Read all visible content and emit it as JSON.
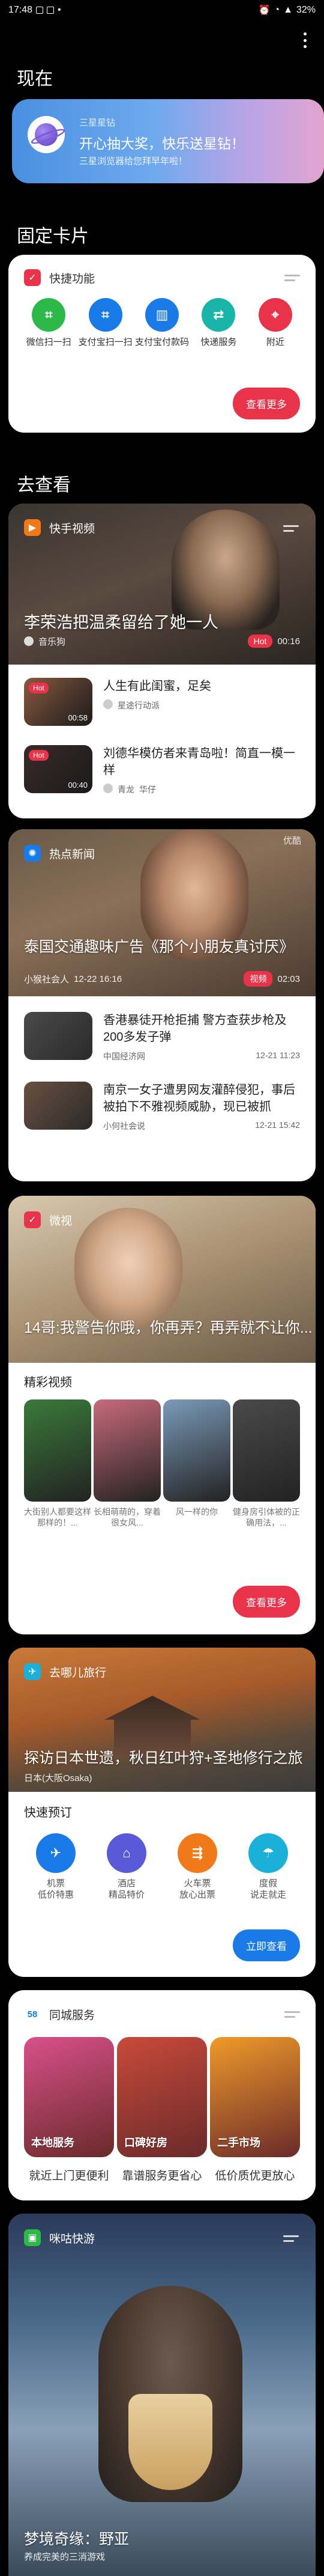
{
  "status": {
    "time": "17:48",
    "battery": "32%"
  },
  "sections": {
    "now": "现在",
    "fixed": "固定卡片",
    "browse": "去查看"
  },
  "banner": {
    "small": "三星星钻",
    "title": "开心抽大奖，快乐送星钻！",
    "sub": "三星浏览器给您拜早年啦！"
  },
  "quick": {
    "title": "快捷功能",
    "items": [
      {
        "label": "微信扫一扫",
        "icon": "scan-icon",
        "color": "#2db84a"
      },
      {
        "label": "支付宝扫一扫",
        "icon": "scan-icon",
        "color": "#1a7be8"
      },
      {
        "label": "支付宝付款码",
        "icon": "barcode-icon",
        "color": "#1a7be8"
      },
      {
        "label": "快递服务",
        "icon": "delivery-icon",
        "color": "#19b5a8"
      },
      {
        "label": "附近",
        "icon": "location-icon",
        "color": "#e8334a"
      }
    ],
    "more": "查看更多"
  },
  "kuaishou": {
    "title": "快手视频",
    "hero_title": "李荣浩把温柔留给了她一人",
    "hero_author": "音乐狗",
    "hero_badge": "Hot",
    "hero_time": "00:16",
    "items": [
      {
        "badge": "Hot",
        "time": "00:58",
        "title": "人生有此闺蜜，足矣",
        "author": "星途行动派"
      },
      {
        "badge": "Hot",
        "time": "00:40",
        "title": "刘德华模仿者来青岛啦！简直一模一样",
        "author": "青龙",
        "author2": "华仔"
      }
    ]
  },
  "news": {
    "title": "热点新闻",
    "source_tag": "优酷",
    "hero_title": "泰国交通趣味广告《那个小朋友真讨厌》",
    "hero_author": "小猴社会人",
    "hero_date": "12-22 16:16",
    "hero_badge": "视频",
    "hero_time": "02:03",
    "items": [
      {
        "title": "香港暴徒开枪拒捕 警方查获步枪及200多发子弹",
        "source": "中国经济网",
        "date": "12-21 11:23"
      },
      {
        "title": "南京一女子遭男网友灌醉侵犯，事后被拍下不雅视频威胁，现已被抓",
        "source": "小何社会说",
        "date": "12-21 15:42"
      }
    ]
  },
  "weishi": {
    "title": "微视",
    "hero_title": "14哥:我警告你哦，你再弄？再弄就不让你...",
    "section": "精彩视频",
    "items": [
      {
        "label": "大街别人都要这样那样的！...",
        "color": "#3a7a3a"
      },
      {
        "label": "长相萌萌的，穿着很女风...",
        "color": "#c86a7a"
      },
      {
        "label": "风一样的你",
        "color": "#7a9ab8"
      },
      {
        "label": "健身房引体被的正确用法，...",
        "color": "#4a4a4a"
      }
    ],
    "more": "查看更多"
  },
  "travel": {
    "title": "去哪儿旅行",
    "hero_title": "探访日本世遗，秋日红叶狩+圣地修行之旅",
    "hero_sub": "日本(大阪Osaka)",
    "section": "快速预订",
    "items": [
      {
        "label": "机票",
        "sub": "低价特惠",
        "icon": "plane-icon",
        "color": "#1a7be8"
      },
      {
        "label": "酒店",
        "sub": "精品特价",
        "icon": "hotel-icon",
        "color": "#5a5ad8"
      },
      {
        "label": "火车票",
        "sub": "放心出票",
        "icon": "train-icon",
        "color": "#f07a1a"
      },
      {
        "label": "度假",
        "sub": "说走就走",
        "icon": "beach-icon",
        "color": "#1ab0d8"
      }
    ],
    "book": "立即查看"
  },
  "city": {
    "title": "同城服务",
    "icon_text": "58",
    "tiles": [
      {
        "label": "本地服务",
        "caption": "就近上门更便利",
        "color": "#d8508a"
      },
      {
        "label": "口碑好房",
        "caption": "靠谱服务更省心",
        "color": "#c84a3a"
      },
      {
        "label": "二手市场",
        "caption": "低价质优更放心",
        "color": "#f09a2a"
      }
    ]
  },
  "migu": {
    "title": "咪咕快游",
    "hero_title": "梦境奇缘：野亚",
    "hero_sub": "养成完美的三消游戏"
  }
}
